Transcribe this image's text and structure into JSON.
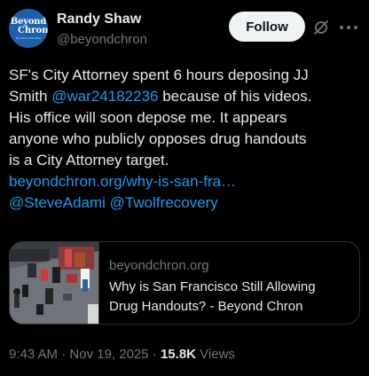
{
  "author": {
    "name": "Randy Shaw",
    "handle": "@beyondchron",
    "avatar": {
      "logo_line1": "Beyond",
      "logo_line2": "Chron",
      "logo_tagline": "The Voice of the Rest",
      "color": "#1d5fa8"
    }
  },
  "actions": {
    "follow_label": "Follow",
    "grok_icon": "grok-icon",
    "more_icon": "more-icon"
  },
  "tweet": {
    "line1": "SF's City Attorney spent 6 hours deposing JJ",
    "line2_before": "Smith ",
    "mention1": "@war24182236",
    "line2_after": " because of his videos.",
    "line3": "His office will soon depose me. It appears",
    "line4": "anyone who publicly opposes drug handouts",
    "line5": "is a City Attorney target.",
    "url": "beyondchron.org/why-is-san-fra…",
    "mention2": "@SteveAdami",
    "mention3": "@Twolfrecovery"
  },
  "card": {
    "domain": "beyondchron.org",
    "title_line1": "Why is San Francisco Still Allowing",
    "title_line2": "Drug Handouts? - Beyond Chron"
  },
  "meta": {
    "time": "9:43 AM",
    "separator1": " · ",
    "date": "Nov 19, 2025",
    "separator2": " · ",
    "views_count": "15.8K",
    "views_label": " Views"
  },
  "colors": {
    "background": "#000000",
    "text": "#e7e9ea",
    "muted": "#71767b",
    "link": "#1d9bf0",
    "border": "#2f3336",
    "button_bg": "#eff3f4"
  }
}
